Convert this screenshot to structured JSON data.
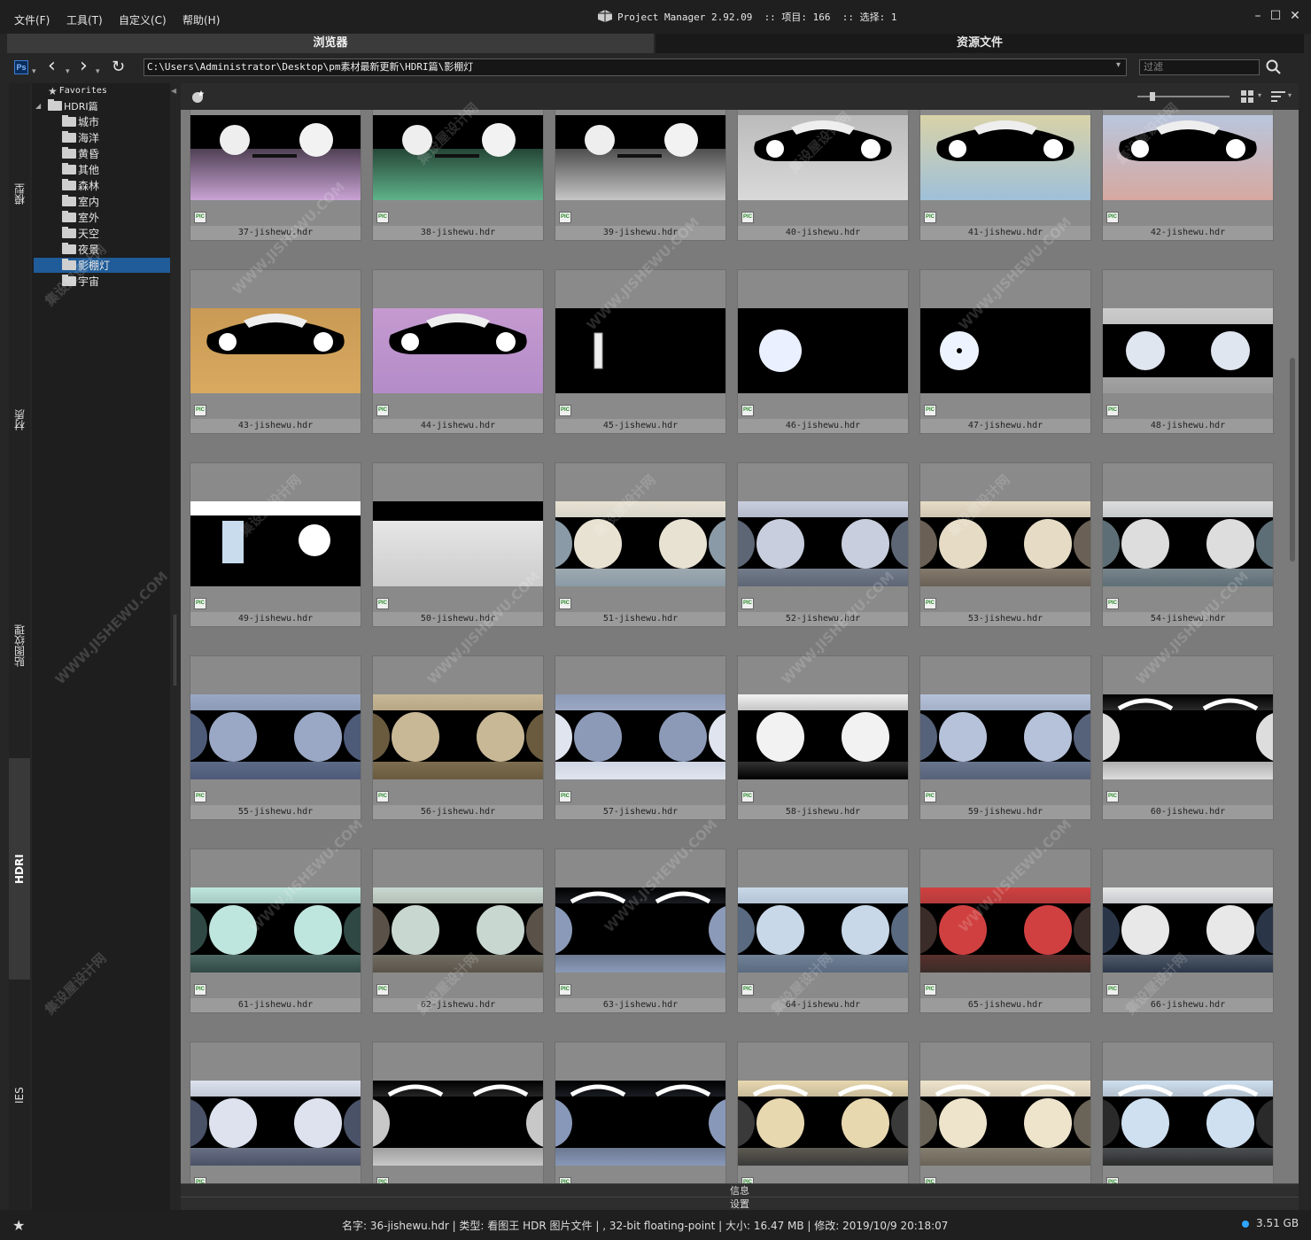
{
  "menu": [
    "文件(F)",
    "工具(T)",
    "自定义(C)",
    "帮助(H)"
  ],
  "title": "Project Manager 2.92.09  :: 项目: 166  :: 选择: 1",
  "tabs": {
    "browser": "浏览器",
    "assets": "资源文件"
  },
  "address": {
    "app_badge": "Ps",
    "path": "C:\\Users\\Administrator\\Desktop\\pm素材最新更新\\HDRI篇\\影棚灯",
    "filter_placeholder": "过滤"
  },
  "vtabs": [
    "模型",
    "材质",
    "贴图纹理",
    "HDRI",
    "IES"
  ],
  "vtabs_active": "HDRI",
  "tree": {
    "favorites": "Favorites",
    "root": "HDRI篇",
    "children": [
      "城市",
      "海洋",
      "黄昏",
      "其他",
      "森林",
      "室内",
      "室外",
      "天空",
      "夜景",
      "影棚灯",
      "宇宙"
    ],
    "selected": "影棚灯"
  },
  "files": [
    "37-jishewu.hdr",
    "38-jishewu.hdr",
    "39-jishewu.hdr",
    "40-jishewu.hdr",
    "41-jishewu.hdr",
    "42-jishewu.hdr",
    "43-jishewu.hdr",
    "44-jishewu.hdr",
    "45-jishewu.hdr",
    "46-jishewu.hdr",
    "47-jishewu.hdr",
    "48-jishewu.hdr",
    "49-jishewu.hdr",
    "50-jishewu.hdr",
    "51-jishewu.hdr",
    "52-jishewu.hdr",
    "53-jishewu.hdr",
    "54-jishewu.hdr",
    "55-jishewu.hdr",
    "56-jishewu.hdr",
    "57-jishewu.hdr",
    "58-jishewu.hdr",
    "59-jishewu.hdr",
    "60-jishewu.hdr",
    "61-jishewu.hdr",
    "62-jishewu.hdr",
    "63-jishewu.hdr",
    "64-jishewu.hdr",
    "65-jishewu.hdr",
    "66-jishewu.hdr",
    "",
    "",
    "",
    "",
    "",
    ""
  ],
  "file_type_badge": "PIC",
  "panels": {
    "info": "信息",
    "settings": "设置"
  },
  "status": {
    "text": "名字: 36-jishewu.hdr | 类型: 看图王 HDR 图片文件 | , 32-bit floating-point | 大小: 16.47 MB | 修改: 2019/10/9 20:18:07",
    "disk": "3.51 GB",
    "disk_color": "#2fa6ff"
  },
  "watermark": [
    "集设屋设计网",
    "WWW.JISHEWU.COM"
  ],
  "icons": [
    "app-logo-icon",
    "minimize-icon",
    "maximize-icon",
    "close-icon",
    "back-icon",
    "forward-icon",
    "refresh-icon",
    "dropdown-icon",
    "search-icon",
    "add-favorite-icon",
    "grid-view-icon",
    "sort-icon",
    "folder-icon",
    "star-icon",
    "pic-file-icon"
  ]
}
